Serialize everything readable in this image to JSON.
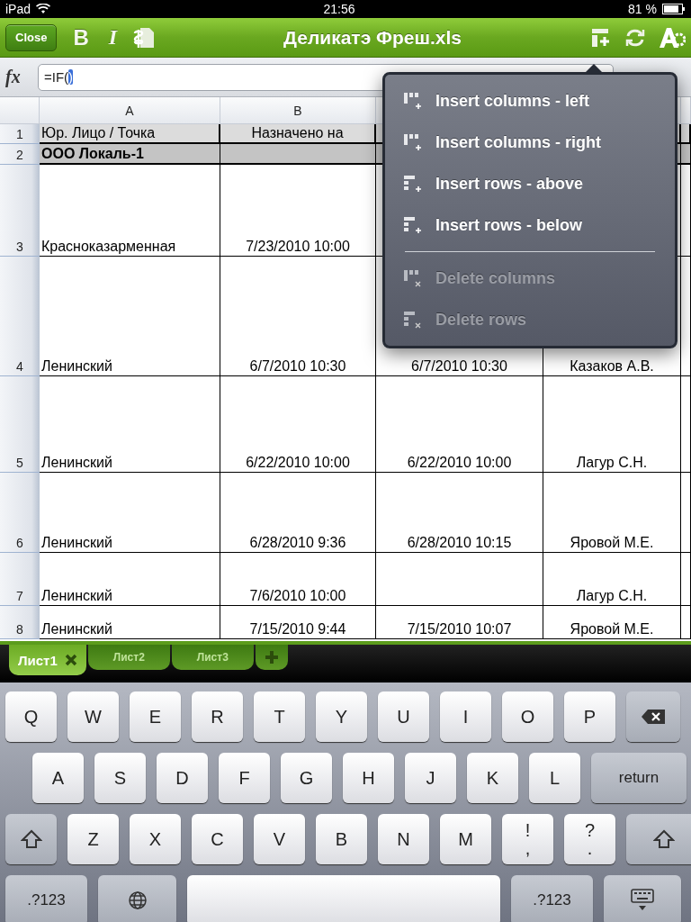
{
  "status_bar": {
    "device": "iPad",
    "time": "21:56",
    "battery": "81 %"
  },
  "toolbar": {
    "close": "Close",
    "bold": "B",
    "italic": "I",
    "title": "Деликатэ Фреш.xls"
  },
  "formula_bar": {
    "label": "fx",
    "value": "=IF(",
    "highlight": ")"
  },
  "columns": [
    "A",
    "B"
  ],
  "rows": [
    {
      "number": "1",
      "kind": "header",
      "cells": [
        "Юр. Лицо / Точка",
        "Назначено на",
        null,
        null,
        null
      ]
    },
    {
      "number": "2",
      "kind": "group",
      "cells": [
        "ООО Локаль-1",
        null,
        null,
        null,
        null
      ]
    },
    {
      "number": "3",
      "kind": "data",
      "cells": [
        "Красноказарменная",
        "7/23/2010 10:00",
        null,
        null,
        null
      ]
    },
    {
      "number": "4",
      "kind": "data",
      "cells": [
        "Ленинский",
        "6/7/2010 10:30",
        "6/7/2010 10:30",
        "Казаков А.В.",
        null
      ]
    },
    {
      "number": "5",
      "kind": "data",
      "cells": [
        "Ленинский",
        "6/22/2010 10:00",
        "6/22/2010 10:00",
        "Лагур  С.Н.",
        null
      ]
    },
    {
      "number": "6",
      "kind": "data",
      "cells": [
        "Ленинский",
        "6/28/2010 9:36",
        "6/28/2010 10:15",
        "Яровой М.Е.",
        null
      ]
    },
    {
      "number": "7",
      "kind": "data",
      "cells": [
        "Ленинский",
        "7/6/2010 10:00",
        null,
        "Лагур  С.Н.",
        null
      ]
    },
    {
      "number": "8",
      "kind": "data",
      "cells": [
        "Ленинский",
        "7/15/2010 9:44",
        "7/15/2010 10:07",
        "Яровой М.Е.",
        null
      ]
    }
  ],
  "popover": {
    "groups": [
      [
        {
          "label": "Insert columns - left",
          "kind": "col-left",
          "disabled": false
        },
        {
          "label": "Insert columns - right",
          "kind": "col-right",
          "disabled": false
        },
        {
          "label": "Insert rows - above",
          "kind": "row-above",
          "disabled": false
        },
        {
          "label": "Insert rows - below",
          "kind": "row-below",
          "disabled": false
        }
      ],
      [
        {
          "label": "Delete columns",
          "kind": "col-delete",
          "disabled": true
        },
        {
          "label": "Delete rows",
          "kind": "row-delete",
          "disabled": true
        }
      ]
    ]
  },
  "sheet_tabs": [
    {
      "label": "Лист1",
      "selected": true
    },
    {
      "label": "Лист2",
      "selected": false
    },
    {
      "label": "Лист3",
      "selected": false
    }
  ],
  "keyboard": {
    "rows": [
      [
        {
          "kind": "letter",
          "label": "Q"
        },
        {
          "kind": "letter",
          "label": "W"
        },
        {
          "kind": "letter",
          "label": "E"
        },
        {
          "kind": "letter",
          "label": "R"
        },
        {
          "kind": "letter",
          "label": "T"
        },
        {
          "kind": "letter",
          "label": "Y"
        },
        {
          "kind": "letter",
          "label": "U"
        },
        {
          "kind": "letter",
          "label": "I"
        },
        {
          "kind": "letter",
          "label": "O"
        },
        {
          "kind": "letter",
          "label": "P"
        },
        {
          "kind": "backspace"
        }
      ],
      [
        {
          "kind": "letter",
          "label": "A"
        },
        {
          "kind": "letter",
          "label": "S"
        },
        {
          "kind": "letter",
          "label": "D"
        },
        {
          "kind": "letter",
          "label": "F"
        },
        {
          "kind": "letter",
          "label": "G"
        },
        {
          "kind": "letter",
          "label": "H"
        },
        {
          "kind": "letter",
          "label": "J"
        },
        {
          "kind": "letter",
          "label": "K"
        },
        {
          "kind": "letter",
          "label": "L"
        },
        {
          "kind": "return",
          "label": "return"
        }
      ],
      [
        {
          "kind": "shift"
        },
        {
          "kind": "letter",
          "label": "Z"
        },
        {
          "kind": "letter",
          "label": "X"
        },
        {
          "kind": "letter",
          "label": "C"
        },
        {
          "kind": "letter",
          "label": "V"
        },
        {
          "kind": "letter",
          "label": "B"
        },
        {
          "kind": "letter",
          "label": "N"
        },
        {
          "kind": "letter",
          "label": "M"
        },
        {
          "kind": "punct",
          "label": "!",
          "sub": ","
        },
        {
          "kind": "punct",
          "label": "?",
          "sub": "."
        },
        {
          "kind": "shift-right"
        }
      ],
      [
        {
          "kind": "symbols",
          "label": ".?123"
        },
        {
          "kind": "globe"
        },
        {
          "kind": "space"
        },
        {
          "kind": "symbols",
          "label": ".?123"
        },
        {
          "kind": "hide"
        }
      ]
    ]
  }
}
